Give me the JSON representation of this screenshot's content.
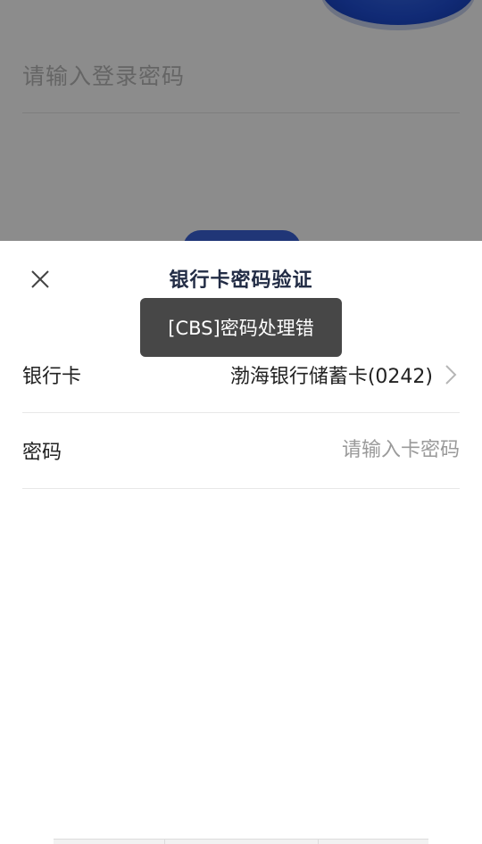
{
  "background": {
    "password_placeholder": "请输入登录密码"
  },
  "sheet": {
    "title": "银行卡密码验证",
    "close_icon": "close-icon",
    "card_row": {
      "label": "银行卡",
      "value": "渤海银行储蓄卡(0242)",
      "icon": "chevron-right-icon"
    },
    "password_row": {
      "label": "密码",
      "placeholder": "请输入卡密码"
    }
  },
  "toast": {
    "message": "[CBS]密码处理错"
  },
  "colors": {
    "title": "#222c45",
    "accent_blue": "#1f4ed6",
    "toast_bg": "#373737"
  }
}
